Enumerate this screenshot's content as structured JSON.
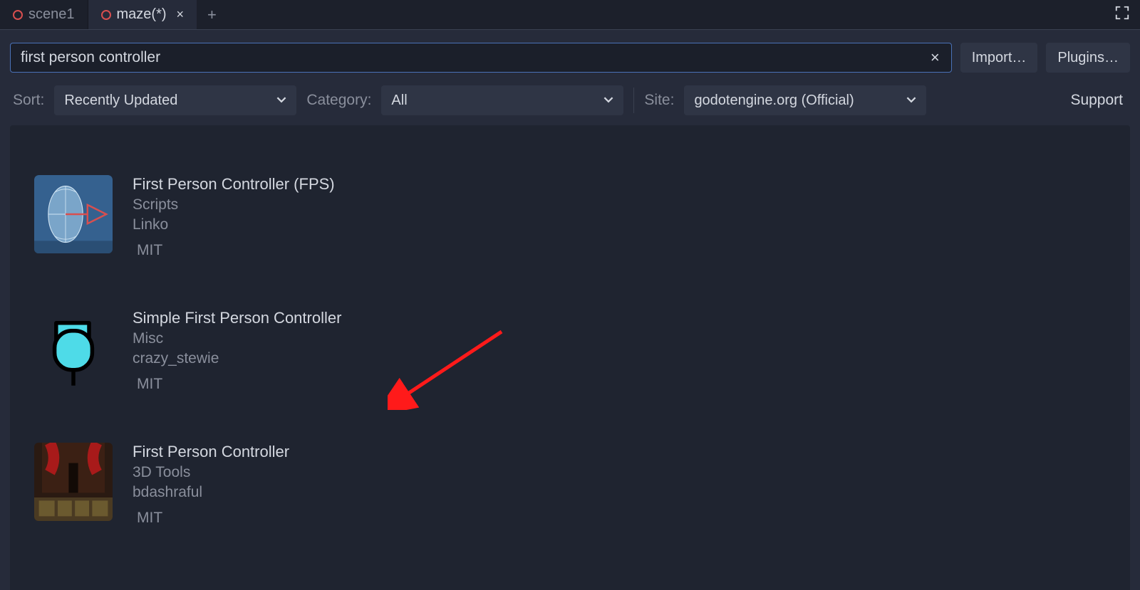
{
  "tabs": {
    "items": [
      {
        "label": "scene1",
        "active": false,
        "modified": false
      },
      {
        "label": "maze(*)",
        "active": true,
        "modified": true
      }
    ]
  },
  "search": {
    "value": "first person controller",
    "buttons": {
      "import": "Import…",
      "plugins": "Plugins…"
    }
  },
  "filters": {
    "sort_label": "Sort:",
    "sort_value": "Recently Updated",
    "category_label": "Category:",
    "category_value": "All",
    "site_label": "Site:",
    "site_value": "godotengine.org (Official)",
    "support_label": "Support"
  },
  "results": [
    {
      "title": "First Person Controller (FPS)",
      "category": "Scripts",
      "author": "Linko",
      "license": "MIT",
      "thumb": "capsule"
    },
    {
      "title": "Simple First Person Controller",
      "category": "Misc",
      "author": "crazy_stewie",
      "license": "MIT",
      "thumb": "flag"
    },
    {
      "title": "First Person Controller",
      "category": "3D Tools",
      "author": "bdashraful",
      "license": "MIT",
      "thumb": "doom"
    }
  ],
  "annotation": {
    "arrow_target_index": 1,
    "color": "#ff1a1a"
  }
}
